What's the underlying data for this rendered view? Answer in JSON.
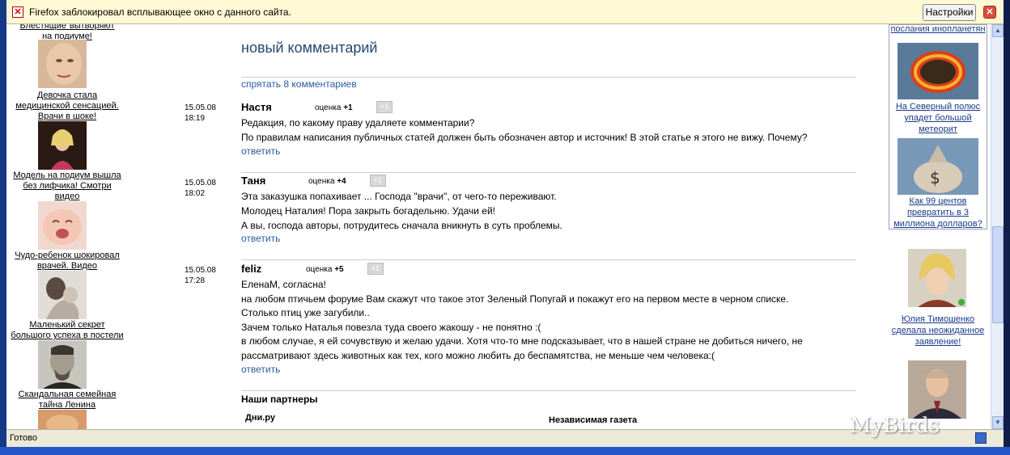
{
  "popup_bar": {
    "message": "Firefox заблокировал всплывающее окно с данного сайта.",
    "settings_button": "Настройки"
  },
  "left_column": {
    "items": [
      {
        "caption_lines": [
          "Блестящие\"вытворяют",
          "на подиуме!"
        ]
      },
      {
        "caption_lines": [
          "Девочка стала",
          "медицинской сенсацией.",
          "Врачи в шоке!"
        ]
      },
      {
        "caption_lines": [
          "Модель на подиум вышла",
          "без лифчика! Смотри",
          "видео"
        ]
      },
      {
        "caption_lines": [
          "Чудо-ребенок шокировал",
          "врачей. Видео"
        ]
      },
      {
        "caption_lines": [
          "Маленький секрет",
          "большого успеха в постели"
        ]
      },
      {
        "caption_lines": [
          "Скандальная семейная",
          "тайна Ленина"
        ]
      }
    ]
  },
  "main": {
    "title": "новый комментарий",
    "hide_comments": "спрятать 8 комментариев",
    "score_label": "оценка",
    "plus_button": "+1",
    "reply_label": "ответить",
    "comments": [
      {
        "date": "15.05.08",
        "time": "18:19",
        "author": "Настя",
        "score": "+1",
        "lines": [
          "Редакция, по какому праву удаляете комментарии?",
          "По правилам написания публичных статей должен быть обозначен автор и источник! В этой статье я этого не вижу. Почему?"
        ]
      },
      {
        "date": "15.05.08",
        "time": "18:02",
        "author": "Таня",
        "score": "+4",
        "lines": [
          "Эта заказушка попахивает ... Господа \"врачи\", от чего-то переживают.",
          "Молодец Наталия! Пора закрыть богадельню. Удачи ей!",
          "А вы, господа авторы, потрудитесь сначала вникнуть в суть проблемы."
        ]
      },
      {
        "date": "15.05.08",
        "time": "17:28",
        "author": "feliz",
        "score": "+5",
        "lines": [
          "ЕленаМ, согласна!",
          "на любом птичьем форуме Вам скажут что такое этот Зеленый Попугай и покажут его на первом месте в черном списке.",
          "Столько птиц уже загубили..",
          "Зачем только Наталья повезла туда своего жакошу - не понятно :(",
          "в любом случае, я ей сочувствую и желаю удачи. Хотя что-то мне подсказывает, что в нашей стране не добиться ничего, не",
          "рассматривают здесь животных как тех, кого можно любить до беспамятства, не меньше чем человека:("
        ]
      }
    ],
    "partners_heading": "Наши партнеры",
    "partners": [
      "Дни.ру",
      "Независимая газета"
    ]
  },
  "right_column": {
    "top_caption": "Ученые расшифровали послания инопланетян",
    "top_caption_visible": "послания инопланетян",
    "items": [
      {
        "caption_lines": [
          "На Северный полюс",
          "упадет большой",
          "метеорит"
        ]
      },
      {
        "caption_lines": [
          "Как 99 центов",
          "превратить в 3",
          "миллиона долларов?"
        ]
      },
      {
        "caption_lines": [
          "Юлия Тимошенко",
          "сделала неожиданное",
          "заявление!"
        ]
      }
    ]
  },
  "status_bar": {
    "text": "Готово"
  },
  "watermark": "MyBirds"
}
